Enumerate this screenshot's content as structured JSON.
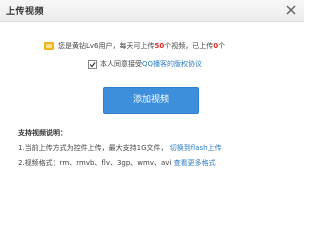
{
  "dialog": {
    "title": "上传视频"
  },
  "quota": {
    "prefix": "您是黄钻Lv6用户，每天可上传",
    "limit": "50",
    "middle": "个视频，已上传",
    "uploaded": "0",
    "suffix": "个"
  },
  "agreement": {
    "text": "本人同意接受",
    "link": "QQ播客的版权协议",
    "checked": true
  },
  "upload_button": "添加视频",
  "support": {
    "title": "支持视频说明：",
    "note1_text": "1.当前上传方式为控件上传，最大支持1G文件，",
    "note1_link": "切换到flash上传",
    "note2_text": "2.视频格式：rm、rmvb、flv、3gp、wmv、avi",
    "note2_link": "查看更多格式"
  },
  "colors": {
    "accent": "#3d8fdc",
    "link": "#2c7cc8",
    "highlight": "#e02a2a"
  }
}
